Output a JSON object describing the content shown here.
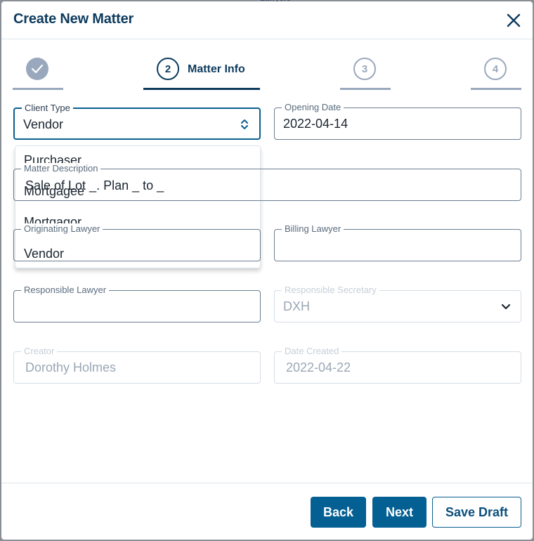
{
  "background": {
    "partial_text": "Lawyers"
  },
  "dialog": {
    "title": "Create New Matter",
    "close_label": "close"
  },
  "stepper": {
    "steps": [
      {
        "number": "1",
        "label": "",
        "state": "completed"
      },
      {
        "number": "2",
        "label": "Matter Info",
        "state": "active"
      },
      {
        "number": "3",
        "label": "",
        "state": "upcoming"
      },
      {
        "number": "4",
        "label": "",
        "state": "upcoming"
      }
    ]
  },
  "form": {
    "client_type": {
      "label": "Client Type",
      "value": "Vendor",
      "options": [
        "Purchaser",
        "Mortgagee",
        "Mortgagor",
        "Vendor"
      ]
    },
    "opening_date": {
      "label": "Opening Date",
      "value": "2022-04-14"
    },
    "matter_description": {
      "label": "Matter Description",
      "value": "Sale of Lot _. Plan _ to _"
    },
    "originating_lawyer": {
      "label": "Originating Lawyer",
      "value": ""
    },
    "billing_lawyer": {
      "label": "Billing Lawyer",
      "value": ""
    },
    "responsible_lawyer": {
      "label": "Responsible Lawyer",
      "value": ""
    },
    "responsible_secretary": {
      "label": "Responsible Secretary",
      "value": "DXH"
    },
    "creator": {
      "label": "Creator",
      "value": "Dorothy Holmes"
    },
    "date_created": {
      "label": "Date Created",
      "value": "2022-04-22"
    }
  },
  "footer": {
    "back_label": "Back",
    "next_label": "Next",
    "save_draft_label": "Save Draft"
  },
  "colors": {
    "primary": "#045f93",
    "title": "#0d3b5e",
    "step_inactive": "#9aa8bd"
  }
}
